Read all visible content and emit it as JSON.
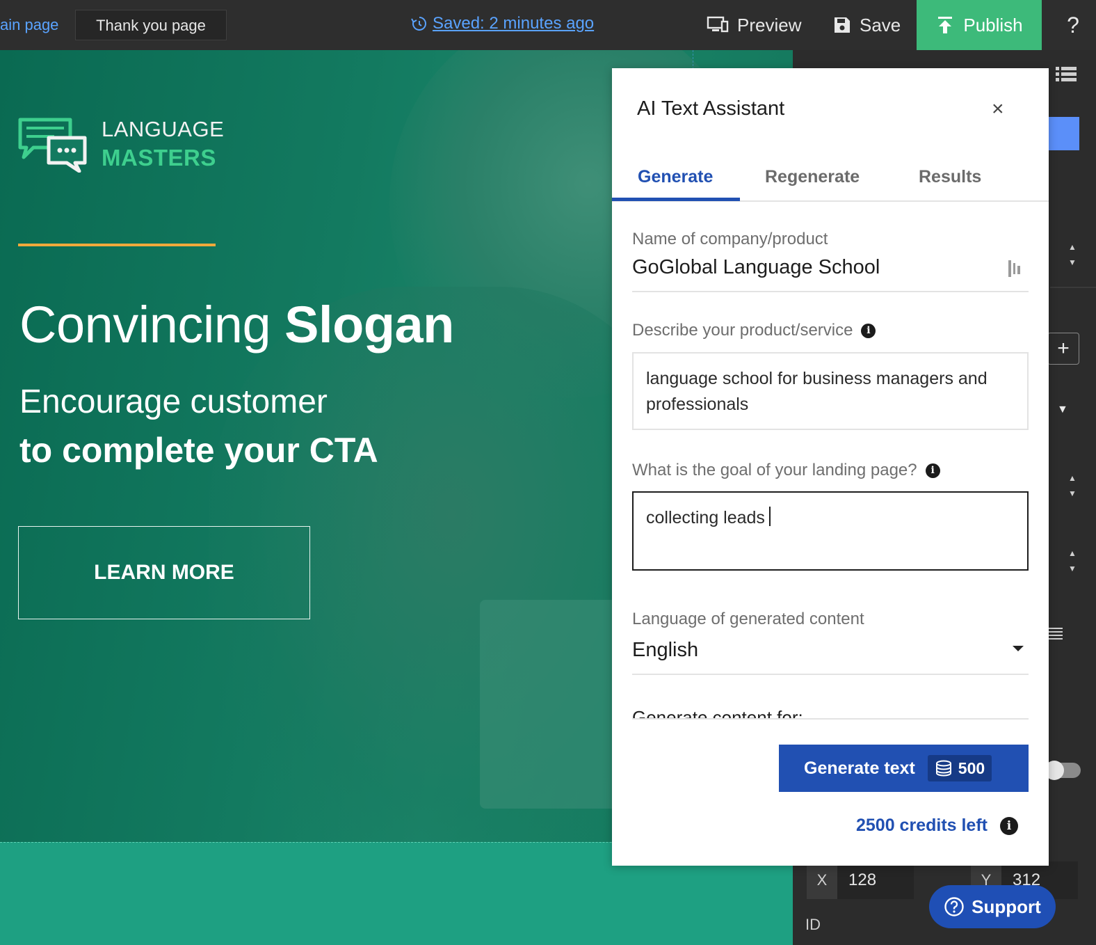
{
  "topbar": {
    "pages": [
      "ain page",
      "Thank you page"
    ],
    "saved_status": "Saved: 2 minutes ago",
    "preview_label": "Preview",
    "save_label": "Save",
    "publish_label": "Publish",
    "help_label": "?"
  },
  "hero": {
    "logo_line1": "LANGUAGE",
    "logo_line2": "MASTERS",
    "headline_regular": "Convincing ",
    "headline_bold": "Slogan",
    "subline1": "Encourage customer",
    "subline2": "to complete your CTA",
    "cta_label": "LEARN MORE"
  },
  "ai_panel": {
    "title": "AI Text Assistant",
    "close_label": "×",
    "tabs": [
      {
        "label": "Generate",
        "active": true
      },
      {
        "label": "Regenerate",
        "active": false
      },
      {
        "label": "Results",
        "active": false
      }
    ],
    "company_label": "Name of company/product",
    "company_value": "GoGlobal Language School",
    "describe_label": "Describe your product/service",
    "describe_value": "language school for business managers and professionals",
    "goal_label": "What is the goal of your landing page?",
    "goal_value": "collecting leads",
    "language_label": "Language of generated content",
    "language_value": "English",
    "generate_for_label": "Generate content for:",
    "generate_button": "Generate text",
    "generate_cost": "500",
    "credits_left": "2500 credits left"
  },
  "side_panel": {
    "x_label": "X",
    "x_value": "128",
    "y_label": "Y",
    "y_value": "312",
    "id_label": "ID"
  },
  "support_label": "Support",
  "colors": {
    "accent_blue": "#2150b2",
    "publish_green": "#3dba7a",
    "hero_green": "#137a60",
    "logo_green": "#3ecf8e",
    "logo_underline": "#f0a93b"
  }
}
